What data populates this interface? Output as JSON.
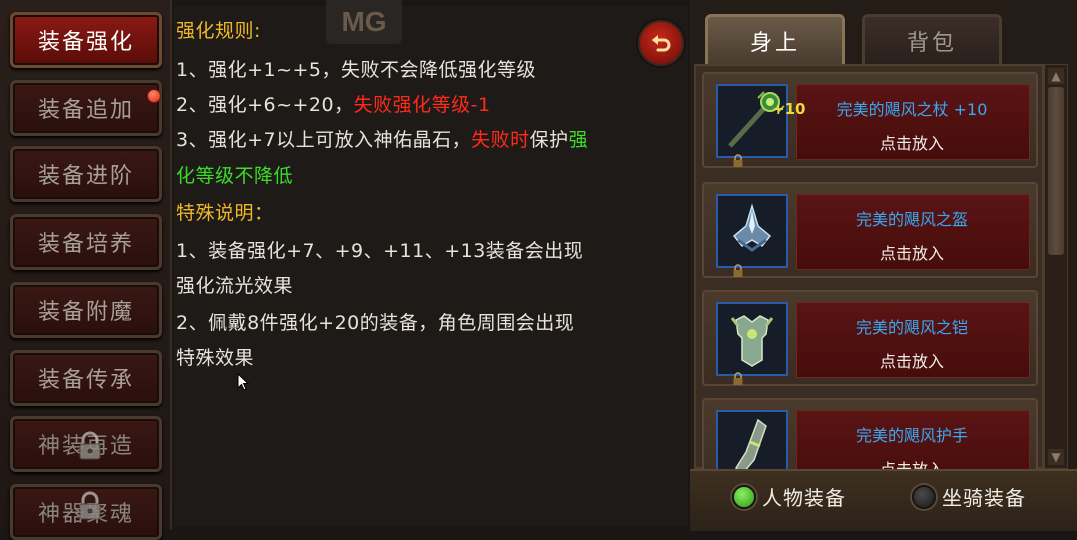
{
  "sidebar": {
    "items": [
      {
        "label": "装备强化",
        "state": "active"
      },
      {
        "label": "装备追加",
        "state": "normal",
        "badge": "red-dot"
      },
      {
        "label": "装备进阶",
        "state": "normal"
      },
      {
        "label": "装备培养",
        "state": "normal"
      },
      {
        "label": "装备附魔",
        "state": "normal"
      },
      {
        "label": "装备传承",
        "state": "normal"
      },
      {
        "label": "神装再造",
        "state": "locked"
      },
      {
        "label": "神器聚魂",
        "state": "locked"
      }
    ]
  },
  "watermark": "MG",
  "rules": {
    "heading1": "强化规则:",
    "rule1": "1、强化+1~+5，失败不会降低强化等级",
    "rule2_prefix": "2、强化+6~+20，",
    "rule2_red": "失败强化等级-1",
    "rule3_prefix": "3、强化+7以上可放入神佑晶石，",
    "rule3_red": "失败时",
    "rule3_mid": "保护",
    "rule3_green_a": "强",
    "rule3_green_b": "化等级不降低",
    "heading2": "特殊说明：",
    "note1_a": "1、装备强化+7、+9、+11、+13装备会出现",
    "note1_b": "强化流光效果",
    "note2_a": "2、佩戴8件强化+20的装备，角色周围会出现",
    "note2_b": "特殊效果"
  },
  "tabs": [
    {
      "label": "身上",
      "active": true
    },
    {
      "label": "背包",
      "active": false
    }
  ],
  "equipment": [
    {
      "name": "完美的飓风之杖 +10",
      "action": "点击放入",
      "enhance_badge": "+10",
      "icon": "staff-icon"
    },
    {
      "name": "完美的飓风之盔",
      "action": "点击放入",
      "icon": "helmet-icon"
    },
    {
      "name": "完美的飓风之铠",
      "action": "点击放入",
      "icon": "armor-icon"
    },
    {
      "name": "完美的飓风护手",
      "action": "点击放入",
      "icon": "gauntlet-icon"
    }
  ],
  "filters": [
    {
      "label": "人物装备",
      "selected": true
    },
    {
      "label": "坐骑装备",
      "selected": false
    }
  ],
  "colors": {
    "accent_gold": "#f0b828",
    "warning_red": "#ff2a18",
    "highlight_green": "#3cdc28",
    "item_name_blue": "#3aa8f0"
  }
}
